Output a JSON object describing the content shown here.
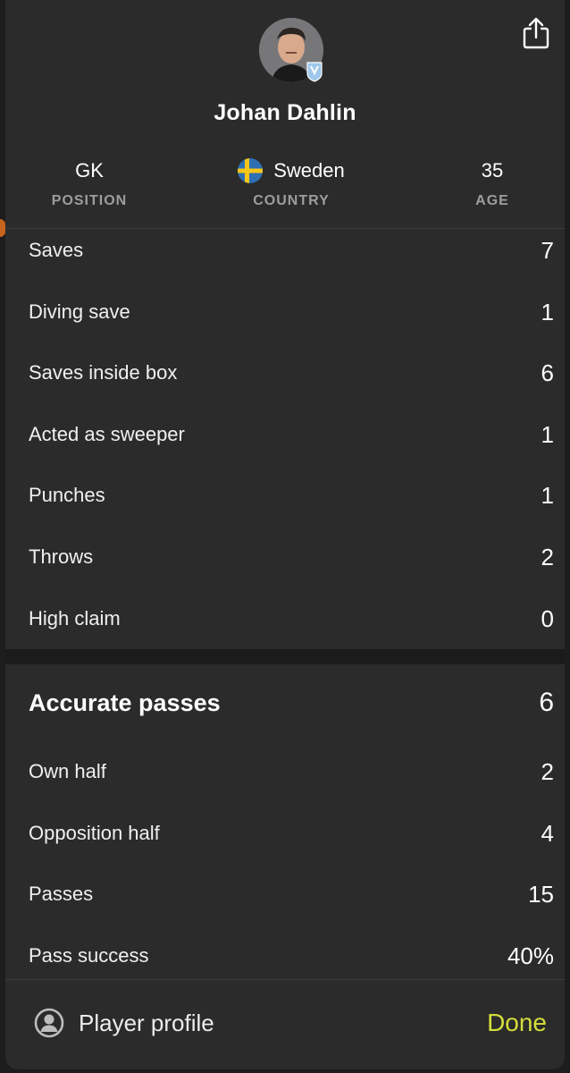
{
  "header": {
    "player_name": "Johan Dahlin",
    "avatar_icon": "player-photo",
    "badge_icon": "club-badge-icon",
    "share_icon": "share-icon"
  },
  "meta": {
    "position": {
      "value": "GK",
      "label": "POSITION"
    },
    "country": {
      "value": "Sweden",
      "label": "COUNTRY",
      "flag_icon": "sweden-flag-icon"
    },
    "age": {
      "value": "35",
      "label": "AGE"
    }
  },
  "goalkeeping_stats": [
    {
      "label": "Saves",
      "value": "7"
    },
    {
      "label": "Diving save",
      "value": "1"
    },
    {
      "label": "Saves inside box",
      "value": "6"
    },
    {
      "label": "Acted as sweeper",
      "value": "1"
    },
    {
      "label": "Punches",
      "value": "1"
    },
    {
      "label": "Throws",
      "value": "2"
    },
    {
      "label": "High claim",
      "value": "0"
    }
  ],
  "passing": {
    "title": "Accurate passes",
    "total": "6",
    "rows": [
      {
        "label": "Own half",
        "value": "2"
      },
      {
        "label": "Opposition half",
        "value": "4"
      },
      {
        "label": "Passes",
        "value": "15"
      },
      {
        "label": "Pass success",
        "value": "40%"
      }
    ]
  },
  "footer": {
    "profile_label": "Player profile",
    "profile_icon": "person-circle-icon",
    "done_label": "Done"
  },
  "colors": {
    "sheet_bg": "#2b2b2b",
    "page_bg": "#1d1d1d",
    "label_muted": "#9d9d9d",
    "accent_done": "#d4dd3a",
    "flag_blue": "#2f6fb3",
    "flag_yellow": "#f5c518"
  }
}
